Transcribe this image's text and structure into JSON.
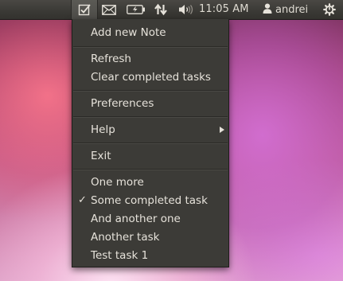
{
  "panel": {
    "clock": "11:05 AM",
    "user": "andrei",
    "icons": [
      "tasks-indicator-icon",
      "mail-icon",
      "battery-icon",
      "network-icon",
      "volume-icon",
      "user-icon",
      "power-gear-icon"
    ]
  },
  "menu": {
    "add_note": "Add new Note",
    "refresh": "Refresh",
    "clear_completed": "Clear completed tasks",
    "preferences": "Preferences",
    "help": "Help",
    "exit": "Exit",
    "tasks": [
      {
        "label": "One more",
        "completed": false
      },
      {
        "label": "Some completed task",
        "completed": true
      },
      {
        "label": "And another one",
        "completed": false
      },
      {
        "label": "Another task",
        "completed": false
      },
      {
        "label": "Test task 1",
        "completed": false
      }
    ],
    "check_glyph": "✓"
  }
}
